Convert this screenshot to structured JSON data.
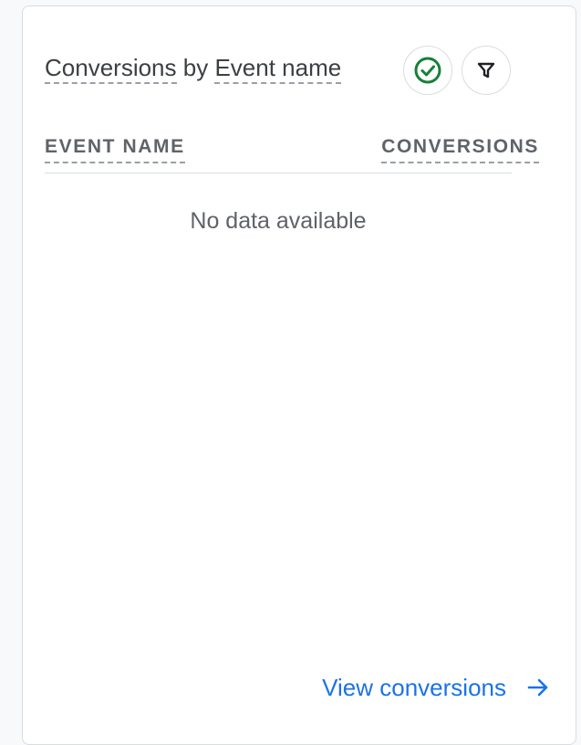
{
  "card": {
    "title_part1": "Conversions",
    "title_by": "by",
    "title_part2": "Event name",
    "compare_icon": "check-circle-icon",
    "filter_icon": "filter-icon"
  },
  "table": {
    "columns": [
      "EVENT NAME",
      "CONVERSIONS"
    ],
    "empty_message": "No data available"
  },
  "footer": {
    "link_label": "View conversions",
    "link_icon": "arrow-right-icon"
  },
  "colors": {
    "accent": "#1a73e8",
    "success": "#188038",
    "text": "#3c4043",
    "muted": "#5f6368"
  }
}
